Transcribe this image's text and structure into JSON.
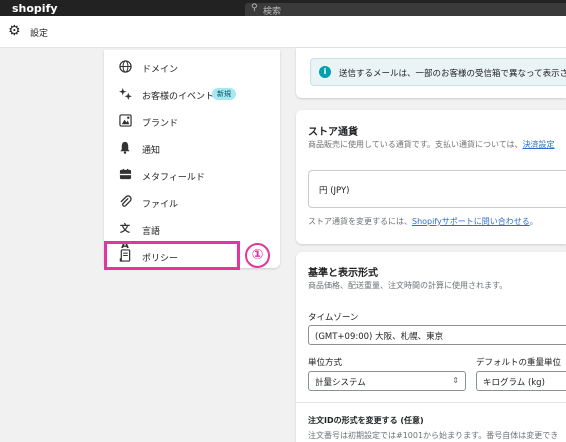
{
  "topbar": {
    "brand": "shopify",
    "search_placeholder": "検索"
  },
  "header": {
    "title": "設定"
  },
  "sidebar": {
    "items": [
      {
        "label": "ドメイン",
        "icon": "globe-icon"
      },
      {
        "label": "お客様のイベント",
        "icon": "sparkle-icon",
        "badge": "新規"
      },
      {
        "label": "ブランド",
        "icon": "brand-icon"
      },
      {
        "label": "通知",
        "icon": "bell-icon"
      },
      {
        "label": "メタフィールド",
        "icon": "metafield-icon"
      },
      {
        "label": "ファイル",
        "icon": "paperclip-icon"
      },
      {
        "label": "言語",
        "icon": "translate-icon"
      },
      {
        "label": "ポリシー",
        "icon": "policy-icon"
      }
    ],
    "callout_number": "①"
  },
  "banner": {
    "text": "送信するメールは、一部のお客様の受信箱で異なって表示さ"
  },
  "currency": {
    "title": "ストア通貨",
    "desc": "商品販売に使用している通貨です。支払い通貨については、",
    "desc_link": "決済設定",
    "value": "円 (JPY)",
    "note": "ストア通貨を変更するには、",
    "note_link": "Shopifyサポートに問い合わせる",
    "note_end": "。"
  },
  "standards": {
    "title": "基準と表示形式",
    "desc": "商品価格、配送重量、注文時間の計算に使用されます。",
    "timezone_label": "タイムゾーン",
    "timezone_value": "(GMT+09:00) 大阪、札幌、東京",
    "unit_label": "単位方式",
    "unit_value": "計量システム",
    "weight_label": "デフォルトの重量単位",
    "weight_value": "キログラム (kg)"
  },
  "order_id": {
    "title": "注文IDの形式を変更する (任意)",
    "desc": "注文番号は初期設定では#1001から始まります。番号自体は変更でき"
  },
  "colors": {
    "highlight": "#e3359e",
    "link": "#2c6ecb",
    "badge_bg": "#a4e8f2"
  }
}
